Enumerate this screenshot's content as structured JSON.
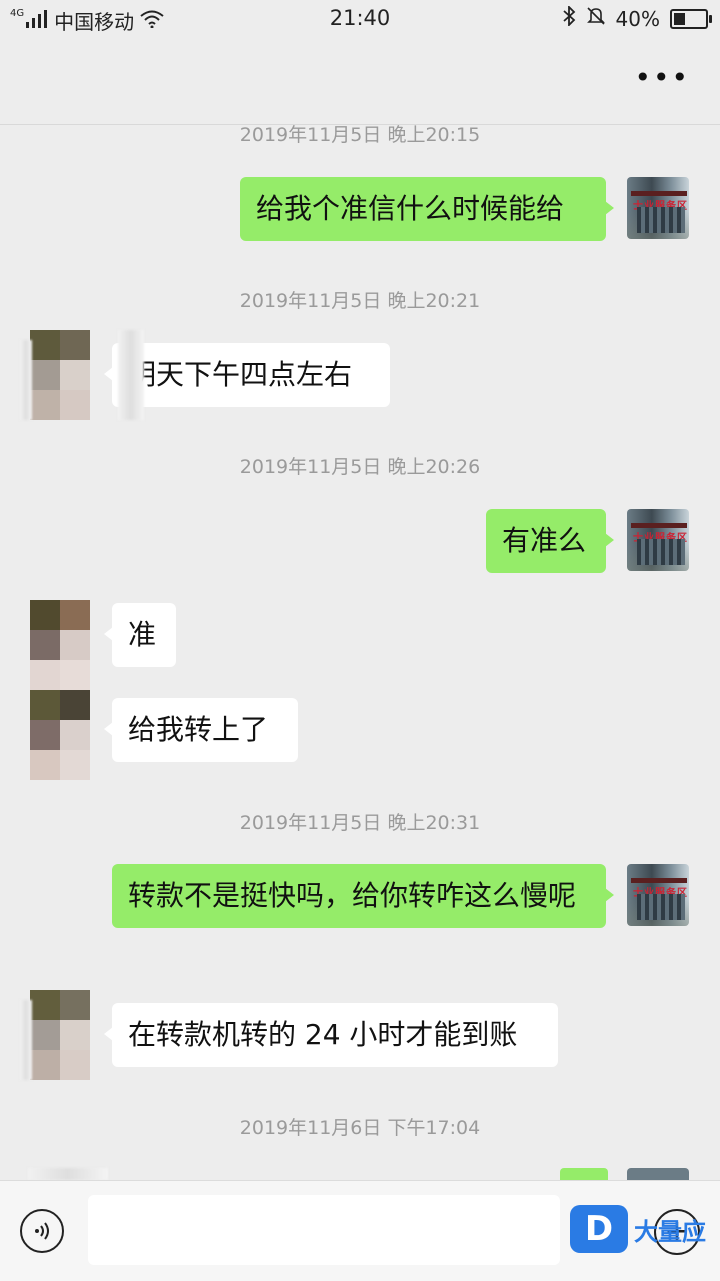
{
  "status_bar": {
    "network": "4G",
    "carrier": "中国移动",
    "time": "21:40",
    "battery": "40%",
    "battery_level": 0.4,
    "icons": [
      "signal-icon",
      "wifi-icon",
      "bluetooth-icon",
      "mute-bell-icon",
      "battery-icon"
    ]
  },
  "nav": {
    "more_label": "•••"
  },
  "messages": {
    "ts1": "2019年11月5日 晚上20:15",
    "m1": "给我个准信什么时候能给",
    "ts2": "2019年11月5日 晚上20:21",
    "m2": "明天下午四点左右",
    "ts3": "2019年11月5日 晚上20:26",
    "m3": "有准么",
    "m4": "准",
    "m5": "给我转上了",
    "ts4": "2019年11月5日 晚上20:31",
    "m6": "转款不是挺快吗，给你转咋这么慢呢",
    "m7": "在转款机转的 24 小时才能到账",
    "ts5": "2019年11月6日 下午17:04"
  },
  "my_avatar": {
    "sign_text": "士业服务区"
  },
  "input_bar": {
    "placeholder": "",
    "voice_icon": "voice-icon",
    "add_icon": "plus-icon"
  },
  "watermark": {
    "logo_letter": "D",
    "text": "大量应"
  },
  "colors": {
    "background": "#ededed",
    "my_bubble": "#95ec69",
    "other_bubble": "#ffffff",
    "timestamp": "#9a9a9a",
    "watermark": "#2a7be4"
  }
}
